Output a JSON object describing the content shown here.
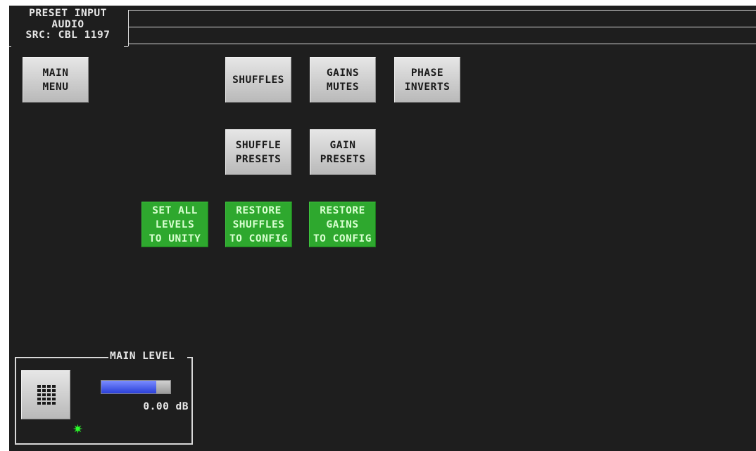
{
  "header": {
    "line1": "PRESET INPUT",
    "line2": "AUDIO",
    "line3": "SRC: CBL 1197"
  },
  "buttons": {
    "main_menu": [
      "MAIN",
      "MENU"
    ],
    "shuffles": [
      "SHUFFLES"
    ],
    "gains_mutes": [
      "GAINS",
      "MUTES"
    ],
    "phase_inverts": [
      "PHASE",
      "INVERTS"
    ],
    "shuffle_presets": [
      "SHUFFLE",
      "PRESETS"
    ],
    "gain_presets": [
      "GAIN",
      "PRESETS"
    ],
    "set_all_levels": [
      "SET ALL",
      "LEVELS",
      "TO UNITY"
    ],
    "restore_shuffles": [
      "RESTORE",
      "SHUFFLES",
      "TO CONFIG"
    ],
    "restore_gains": [
      "RESTORE",
      "GAINS",
      "TO CONFIG"
    ]
  },
  "main_level": {
    "title": "MAIN LEVEL",
    "value_text": "0.00 dB",
    "level_fraction": 0.8,
    "keypad_icon": "keypad-grid-icon",
    "status_icon": "green-star-icon"
  },
  "colors": {
    "background": "#1e1e1e",
    "button_gray": "#cfcfcf",
    "button_green": "#2ea82e",
    "meter_fill": "#3f56e8",
    "status_star": "#2bff2b"
  }
}
